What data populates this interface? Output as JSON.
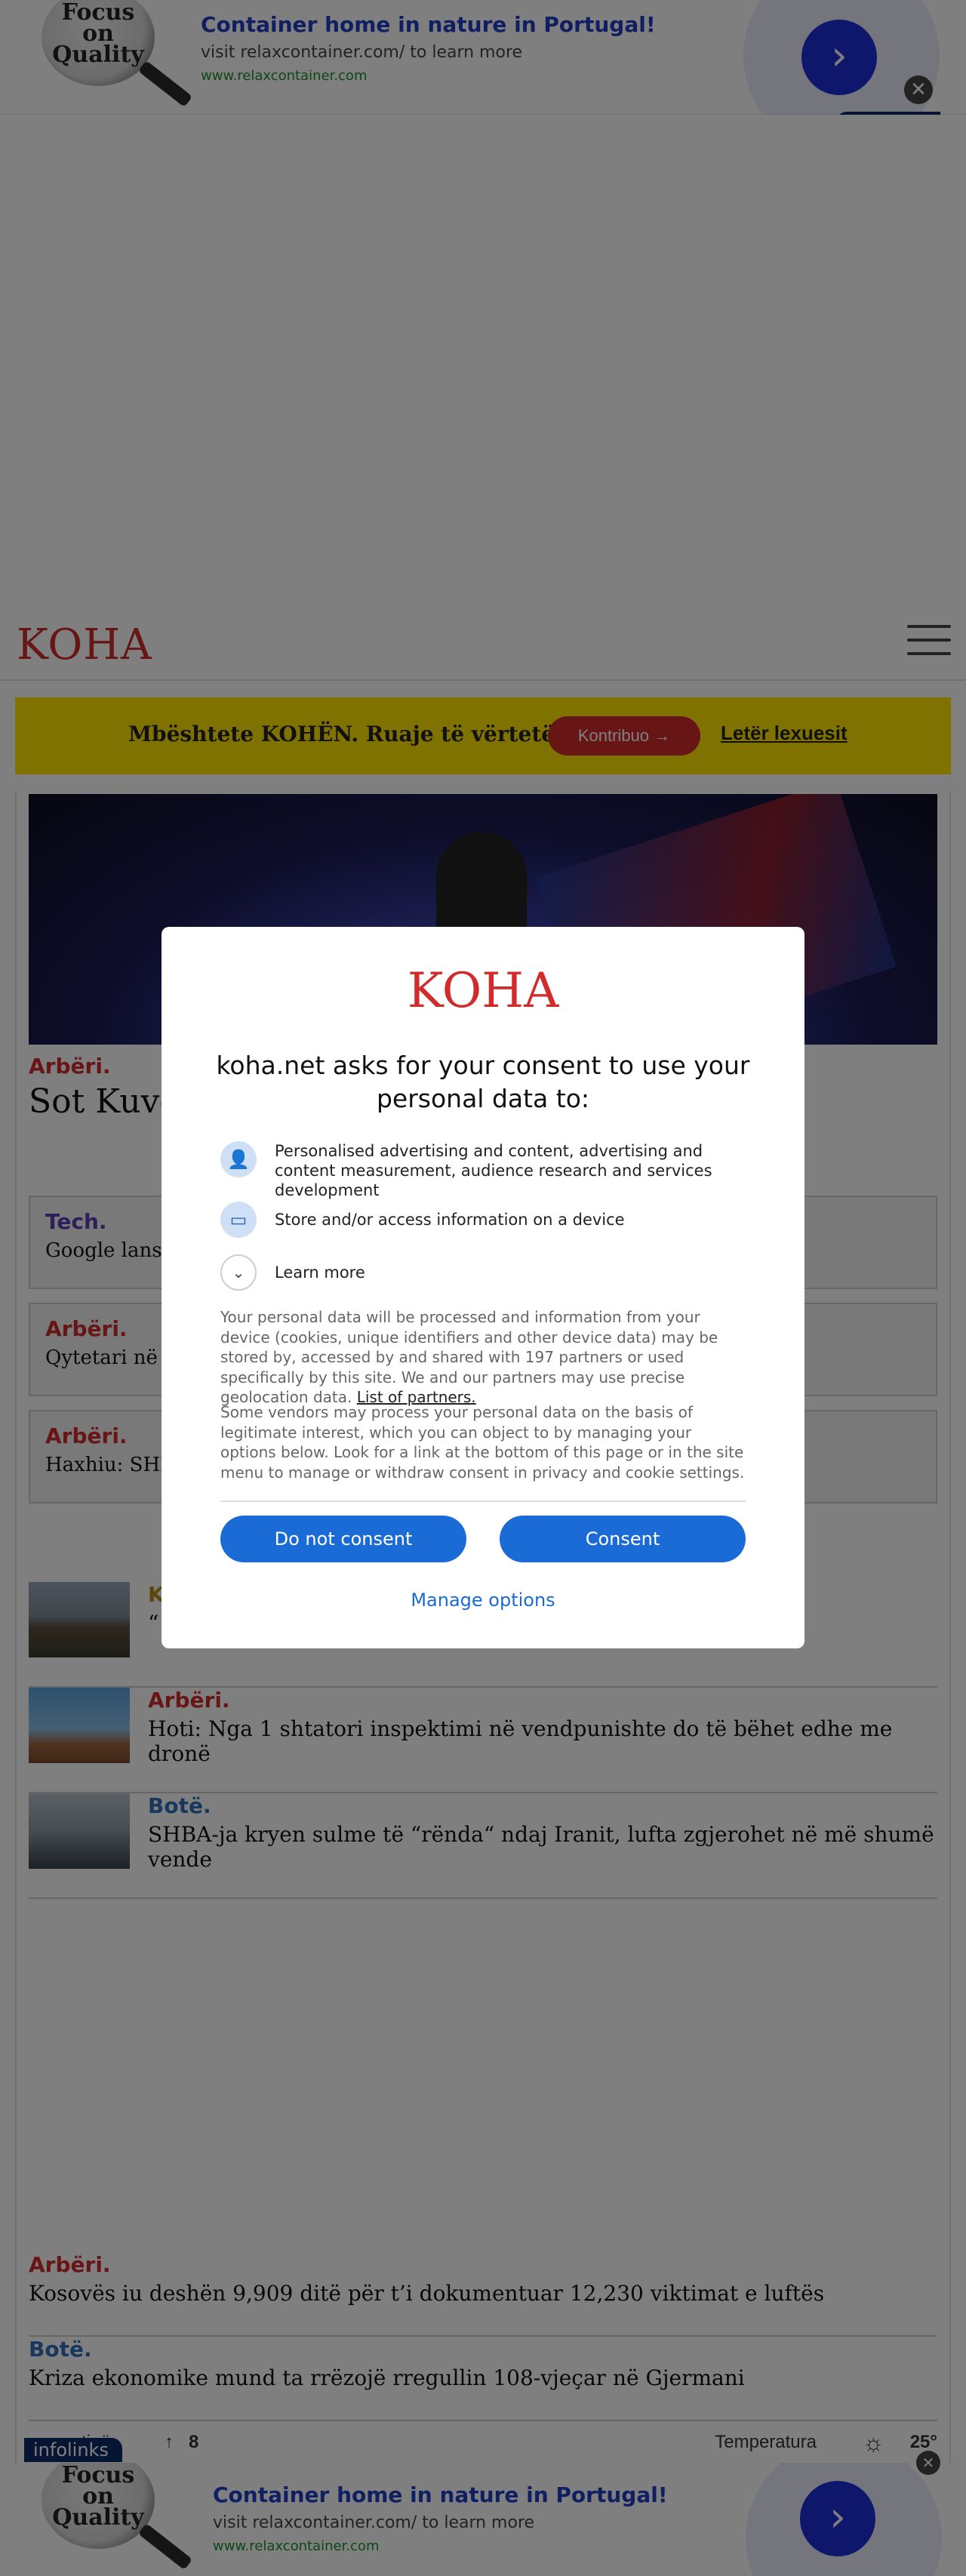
{
  "ad": {
    "logo_lines": [
      "Focus",
      "on",
      "Quality"
    ],
    "title": "Container home in nature in Portugal!",
    "subtitle": "visit relaxcontainer.com/ to learn more",
    "url": "www.relaxcontainer.com",
    "arrow": "›",
    "close": "✕",
    "infolinks": "infolinks"
  },
  "site": {
    "brand": "KOHA",
    "support": {
      "text": "Mbështete KOHËN. Ruaje të vërtetën",
      "button": "Kontribuo →",
      "link": "Letër lexuesit"
    },
    "hero": {
      "category": "Arbëri.",
      "title": "Sot Kuve"
    },
    "boxed_items": [
      {
        "category": "Tech.",
        "title": "Google lansor"
      },
      {
        "category": "Arbëri.",
        "title": "Qytetari në Ra"
      },
      {
        "category": "Arbëri.",
        "title": "Haxhiu: SHBA"
      }
    ],
    "list_items": [
      {
        "category": "K",
        "title": "“"
      },
      {
        "category": "Arbëri.",
        "title": "Hoti: Nga 1 shtatori inspektimi në vendpunishte do të bëhet edhe me dronë"
      },
      {
        "category": "Botë.",
        "title": "SHBA-ja kryen sulme të “rënda“ ndaj Iranit, lufta zgjerohet në më shumë vende"
      }
    ],
    "plain_items": [
      {
        "category": "Arbëri.",
        "title": "Kosovës iu deshën 9,909 ditë për t’i dokumentuar 12,230 viktimat e luftës"
      },
      {
        "category": "Botë.",
        "title": "Kriza ekonomike mund ta rrëzojë rregullin 108-vjeçar në Gjermani"
      }
    ],
    "footer": {
      "label": "tinë",
      "arrow": "↑",
      "count": "8",
      "temp_label": "Temperatura",
      "temp_value": "25°"
    }
  },
  "consent": {
    "logo": "KOHA",
    "heading": "koha.net asks for your consent to use your personal data to:",
    "purposes": [
      {
        "icon": "person-icon",
        "glyph": "👤",
        "text": "Personalised advertising and content, advertising and content measurement, audience research and services development"
      },
      {
        "icon": "device-icon",
        "glyph": "▭",
        "text": "Store and/or access information on a device"
      },
      {
        "icon": "chevron-down-icon",
        "glyph": "⌄",
        "text": "Learn more"
      }
    ],
    "paragraph1": "Your personal data will be processed and information from your device (cookies, unique identifiers and other device data) may be stored by, accessed by and shared with 197 partners or used specifically by this site. We and our partners may use precise geolocation data.",
    "partners_link": "List of partners.",
    "paragraph2": "Some vendors may process your personal data on the basis of legitimate interest, which you can object to by managing your options below. Look for a link at the bottom of this page or in the site menu to manage or withdraw consent in privacy and cookie settings.",
    "do_not_consent": "Do not consent",
    "consent": "Consent",
    "manage": "Manage options"
  },
  "colors": {
    "brand_red": "#d12b2b",
    "support_yellow": "#ffe400",
    "consent_blue": "#1b6bd6",
    "ad_blue": "#1c2ed6"
  }
}
